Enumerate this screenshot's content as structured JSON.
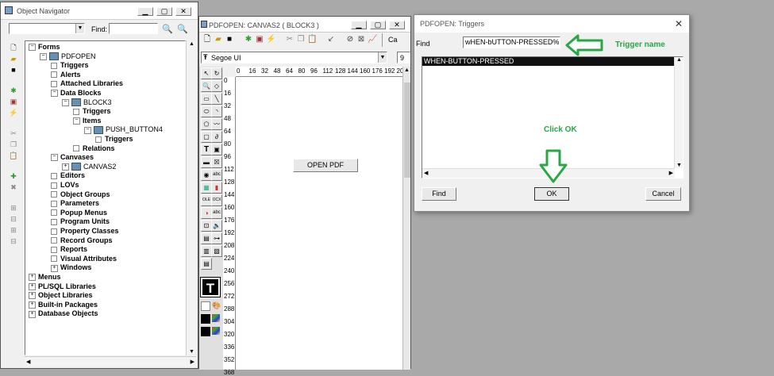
{
  "navigator": {
    "title": "Object Navigator",
    "find_label": "Find:",
    "find_value": "",
    "tree": [
      {
        "label": "Forms",
        "depth": 0,
        "bold": true,
        "expander": "-"
      },
      {
        "label": "PDFOPEN",
        "depth": 1,
        "bold": false,
        "expander": "-",
        "icon": true
      },
      {
        "label": "Triggers",
        "depth": 2,
        "bold": true
      },
      {
        "label": "Alerts",
        "depth": 2,
        "bold": true
      },
      {
        "label": "Attached Libraries",
        "depth": 2,
        "bold": true
      },
      {
        "label": "Data Blocks",
        "depth": 2,
        "bold": true,
        "expander": "-"
      },
      {
        "label": "BLOCK3",
        "depth": 3,
        "bold": false,
        "expander": "-",
        "icon": true
      },
      {
        "label": "Triggers",
        "depth": 4,
        "bold": true
      },
      {
        "label": "Items",
        "depth": 4,
        "bold": true,
        "expander": "-"
      },
      {
        "label": "PUSH_BUTTON4",
        "depth": 5,
        "bold": false,
        "expander": "-",
        "icon": true
      },
      {
        "label": "Triggers",
        "depth": 6,
        "bold": true
      },
      {
        "label": "Relations",
        "depth": 4,
        "bold": true
      },
      {
        "label": "Canvases",
        "depth": 2,
        "bold": true,
        "expander": "-"
      },
      {
        "label": "CANVAS2",
        "depth": 3,
        "bold": false,
        "expander": "+",
        "icon": true
      },
      {
        "label": "Editors",
        "depth": 2,
        "bold": true
      },
      {
        "label": "LOVs",
        "depth": 2,
        "bold": true
      },
      {
        "label": "Object Groups",
        "depth": 2,
        "bold": true
      },
      {
        "label": "Parameters",
        "depth": 2,
        "bold": true
      },
      {
        "label": "Popup Menus",
        "depth": 2,
        "bold": true
      },
      {
        "label": "Program Units",
        "depth": 2,
        "bold": true
      },
      {
        "label": "Property Classes",
        "depth": 2,
        "bold": true
      },
      {
        "label": "Record Groups",
        "depth": 2,
        "bold": true
      },
      {
        "label": "Reports",
        "depth": 2,
        "bold": true
      },
      {
        "label": "Visual Attributes",
        "depth": 2,
        "bold": true
      },
      {
        "label": "Windows",
        "depth": 2,
        "bold": true,
        "expander": "+"
      },
      {
        "label": "Menus",
        "depth": 0,
        "bold": true,
        "expander": "+"
      },
      {
        "label": "PL/SQL Libraries",
        "depth": 0,
        "bold": true,
        "expander": "+"
      },
      {
        "label": "Object Libraries",
        "depth": 0,
        "bold": true,
        "expander": "+"
      },
      {
        "label": "Built-in Packages",
        "depth": 0,
        "bold": true,
        "expander": "+"
      },
      {
        "label": "Database Objects",
        "depth": 0,
        "bold": true,
        "expander": "+"
      }
    ]
  },
  "canvas": {
    "title": "PDFOPEN: CANVAS2 ( BLOCK3 )",
    "font": "Segoe UI",
    "font_size": "9",
    "toolbar_cut_text": "Ca",
    "button_label": "OPEN PDF",
    "ruler_top": [
      "0",
      "16",
      "32",
      "48",
      "64",
      "80",
      "96",
      "112",
      "128",
      "144",
      "160",
      "176",
      "192",
      "20"
    ],
    "ruler_left": [
      "0",
      "16",
      "32",
      "48",
      "64",
      "80",
      "96",
      "112",
      "128",
      "144",
      "160",
      "176",
      "192",
      "208",
      "224",
      "240",
      "256",
      "272",
      "288",
      "304",
      "320",
      "336",
      "352",
      "368"
    ]
  },
  "dialog": {
    "title": "PDFOPEN: Triggers",
    "find_label": "Find",
    "find_value": "wHEN-bUTTON-PRESSED%",
    "list_items": [
      "WHEN-BUTTON-PRESSED"
    ],
    "find_button": "Find",
    "ok_button": "OK",
    "cancel_button": "Cancel"
  },
  "annotations": {
    "trigger_name": "Trigger name",
    "click_ok": "Click OK",
    "color": "#28a745"
  }
}
